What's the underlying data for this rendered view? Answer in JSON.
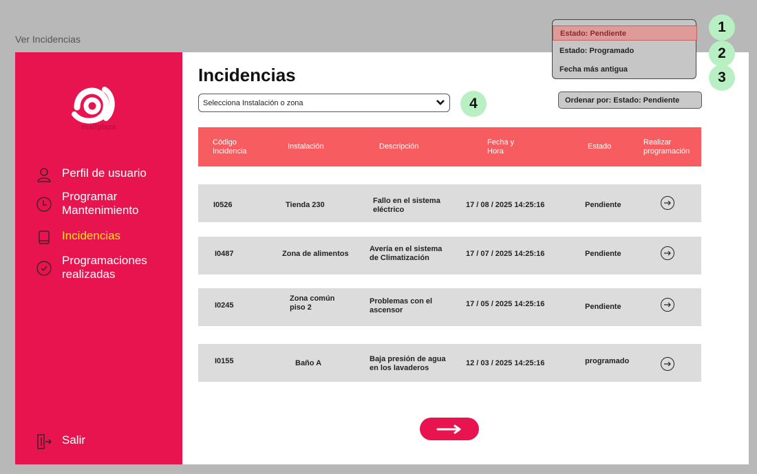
{
  "window": {
    "title": "Ver Incidencias"
  },
  "brand": {
    "name": "mallplaza",
    "color": "#e8144f",
    "accent": "#f8e51c"
  },
  "sidebar": {
    "items": [
      {
        "label": "Perfil de usuario",
        "icon": "user-icon"
      },
      {
        "label": "Programar Mantenimiento",
        "icon": "clock-icon"
      },
      {
        "label": "Incidencias",
        "icon": "tablet-icon",
        "active": true
      },
      {
        "label": "Programaciones realizadas",
        "icon": "check-circle-icon"
      }
    ],
    "logout_label": "Salir"
  },
  "main": {
    "title": "Incidencias",
    "filter": {
      "selected": "Selecciona Instalación o zona"
    },
    "sort": {
      "label": "Ordenar por:  Estado: Pendiente"
    },
    "sort_menu": {
      "options": [
        "Estado: Pendiente",
        "Estado: Programado",
        "Fecha más antigua"
      ],
      "selected": "Estado: Pendiente"
    },
    "badges": [
      "1",
      "2",
      "3",
      "4"
    ],
    "table": {
      "headers": [
        "Código Incidencia",
        "Instalación",
        "Descripción",
        "Fecha y Hora",
        "Estado",
        "Realizar programación"
      ],
      "rows": [
        {
          "code": "I0526",
          "installation": "Tienda 230",
          "description": "Fallo en el sistema eléctrico",
          "datetime": "17 / 08 / 2025  14:25:16",
          "status": "Pendiente"
        },
        {
          "code": "I0487",
          "installation": "Zona de alimentos",
          "description": "Avería en el sistema de Climatización",
          "datetime": "17 / 07 / 2025  14:25:16",
          "status": "Pendiente"
        },
        {
          "code": "I0245",
          "installation": "Zona común piso 2",
          "description": "Problemas con el ascensor",
          "datetime": "17 / 05 / 2025  14:25:16",
          "status": "Pendiente"
        },
        {
          "code": "I0155",
          "installation": "Baño A",
          "description": "Baja  presión de agua en los lavaderos",
          "datetime": "12 / 03 / 2025  14:25:16",
          "status": "programado"
        }
      ]
    }
  }
}
